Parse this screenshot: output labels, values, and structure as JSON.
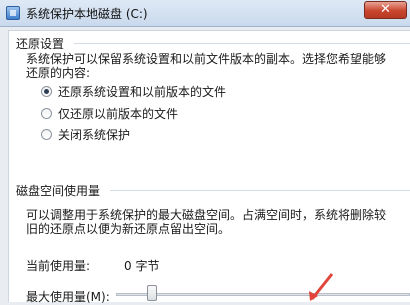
{
  "window": {
    "title": "系统保护本地磁盘 (C:)",
    "close_glyph": "✕"
  },
  "restore": {
    "heading": "还原设置",
    "description_line1": "系统保护可以保留系统设置和以前文件版本的副本。选择您希望能够",
    "description_line2": "还原的内容:",
    "options": [
      {
        "label": "还原系统设置和以前版本的文件",
        "selected": true
      },
      {
        "label": "仅还原以前版本的文件",
        "selected": false
      },
      {
        "label": "关闭系统保护",
        "selected": false
      }
    ]
  },
  "disk": {
    "heading": "磁盘空间使用量",
    "description_line1": "可以调整用于系统保护的最大磁盘空间。占满空间时，系统将删除较",
    "description_line2": "旧的还原点以便为新还原点留出空间。",
    "current_usage_label": "当前使用量:",
    "current_usage_value": "0 字节",
    "max_usage_label": "最大使用量(M):"
  },
  "colors": {
    "annotation_arrow": "#e0443a"
  }
}
